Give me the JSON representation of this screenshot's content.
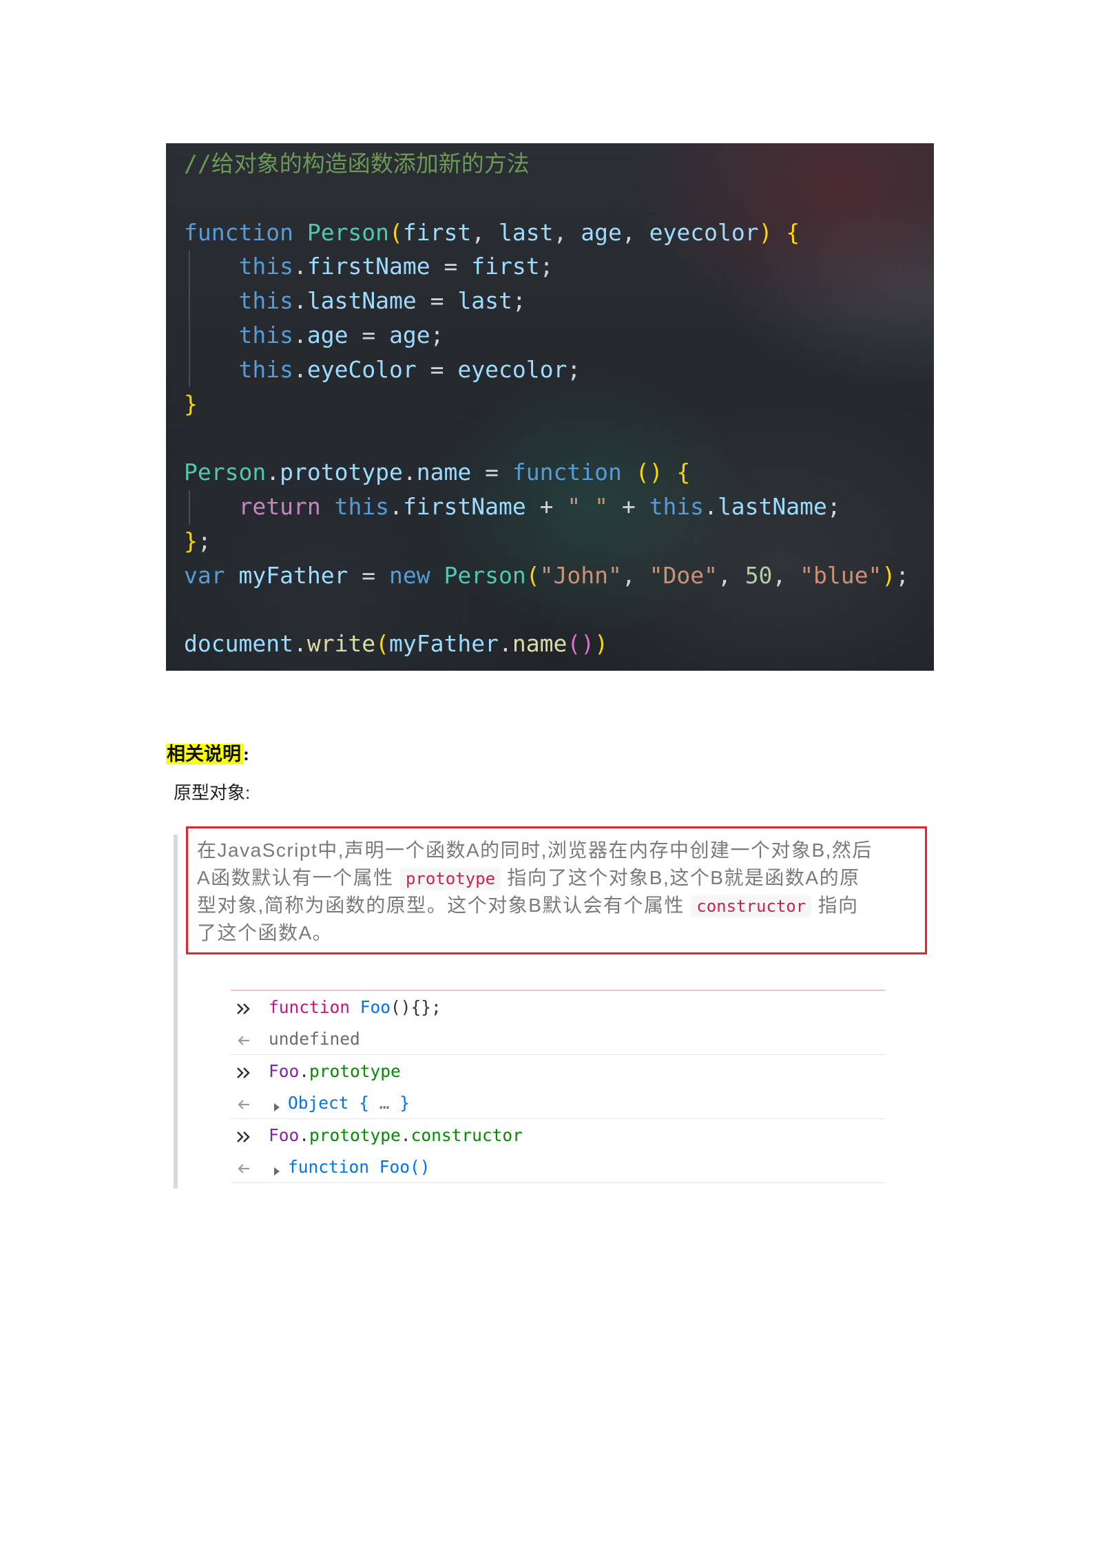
{
  "code_screenshot": {
    "colors": {
      "background": "#24282d",
      "comment": "#6a9955",
      "keyword": "#569cd6",
      "control": "#c586c0",
      "class": "#4ec9b0",
      "variable": "#9cdcfe",
      "function": "#dcdcaa",
      "string": "#ce9178",
      "number": "#b5cea8",
      "bracket": "#ffd700",
      "bracket_nested": "#da70d6",
      "plain": "#d4d4d4"
    },
    "lines": [
      [
        {
          "comment": "//给对象的构造函数添加新的方法"
        }
      ],
      [],
      [
        {
          "keyword": "function"
        },
        {
          "plain": " "
        },
        {
          "class": "Person"
        },
        {
          "bracket": "("
        },
        {
          "variable": "first"
        },
        {
          "plain": ", "
        },
        {
          "variable": "last"
        },
        {
          "plain": ", "
        },
        {
          "variable": "age"
        },
        {
          "plain": ", "
        },
        {
          "variable": "eyecolor"
        },
        {
          "bracket": ")"
        },
        {
          "plain": " "
        },
        {
          "bracket": "{"
        }
      ],
      [
        {
          "plain": "    "
        },
        {
          "keyword": "this"
        },
        {
          "plain": "."
        },
        {
          "variable": "firstName"
        },
        {
          "plain": " = "
        },
        {
          "variable": "first"
        },
        {
          "plain": ";"
        }
      ],
      [
        {
          "plain": "    "
        },
        {
          "keyword": "this"
        },
        {
          "plain": "."
        },
        {
          "variable": "lastName"
        },
        {
          "plain": " = "
        },
        {
          "variable": "last"
        },
        {
          "plain": ";"
        }
      ],
      [
        {
          "plain": "    "
        },
        {
          "keyword": "this"
        },
        {
          "plain": "."
        },
        {
          "variable": "age"
        },
        {
          "plain": " = "
        },
        {
          "variable": "age"
        },
        {
          "plain": ";"
        }
      ],
      [
        {
          "plain": "    "
        },
        {
          "keyword": "this"
        },
        {
          "plain": "."
        },
        {
          "variable": "eyeColor"
        },
        {
          "plain": " = "
        },
        {
          "variable": "eyecolor"
        },
        {
          "plain": ";"
        }
      ],
      [
        {
          "bracket": "}"
        }
      ],
      [],
      [
        {
          "class": "Person"
        },
        {
          "plain": "."
        },
        {
          "variable": "prototype"
        },
        {
          "plain": "."
        },
        {
          "variable": "name"
        },
        {
          "plain": " = "
        },
        {
          "keyword": "function"
        },
        {
          "plain": " "
        },
        {
          "bracket": "()"
        },
        {
          "plain": " "
        },
        {
          "bracket": "{"
        }
      ],
      [
        {
          "plain": "    "
        },
        {
          "control": "return"
        },
        {
          "plain": " "
        },
        {
          "keyword": "this"
        },
        {
          "plain": "."
        },
        {
          "variable": "firstName"
        },
        {
          "plain": " + "
        },
        {
          "string": "\" \""
        },
        {
          "plain": " + "
        },
        {
          "keyword": "this"
        },
        {
          "plain": "."
        },
        {
          "variable": "lastName"
        },
        {
          "plain": ";"
        }
      ],
      [
        {
          "bracket": "}"
        },
        {
          "plain": ";"
        }
      ],
      [
        {
          "keyword": "var"
        },
        {
          "plain": " "
        },
        {
          "variable": "myFather"
        },
        {
          "plain": " = "
        },
        {
          "keyword": "new"
        },
        {
          "plain": " "
        },
        {
          "class": "Person"
        },
        {
          "bracket": "("
        },
        {
          "string": "\"John\""
        },
        {
          "plain": ", "
        },
        {
          "string": "\"Doe\""
        },
        {
          "plain": ", "
        },
        {
          "number": "50"
        },
        {
          "plain": ", "
        },
        {
          "string": "\"blue\""
        },
        {
          "bracket": ")"
        },
        {
          "plain": ";"
        }
      ],
      [],
      [
        {
          "variable": "document"
        },
        {
          "plain": "."
        },
        {
          "function": "write"
        },
        {
          "bracket": "("
        },
        {
          "variable": "myFather"
        },
        {
          "plain": "."
        },
        {
          "function": "name"
        },
        {
          "bracket_nested": "()"
        },
        {
          "bracket": ")"
        }
      ]
    ]
  },
  "notes": {
    "heading": "相关说明",
    "heading_suffix": ":",
    "subheading": "原型对象:",
    "highlight_color": "#ffff00",
    "box_border_color": "#e0262c",
    "inline_code_color": "#c7254e",
    "quote_lines": [
      [
        {
          "text": "在JavaScript中,声明一个函数A的同时,浏览器在内存中创建一个对象B,然后"
        }
      ],
      [
        {
          "text": "A函数默认有一个属性 "
        },
        {
          "code": "prototype"
        },
        {
          "text": " 指向了这个对象B,这个B就是函数A的原"
        }
      ],
      [
        {
          "text": "型对象,简称为函数的原型。这个对象B默认会有个属性 "
        },
        {
          "code": "constructor"
        },
        {
          "text": " 指向"
        }
      ],
      [
        {
          "text": "了这个函数A。"
        }
      ]
    ]
  },
  "console": {
    "colors": {
      "keyword": "#c3157f",
      "name": "#0074e8",
      "punct": "#333333",
      "undefined": "#6b6b6b",
      "variable": "#8a1fa8",
      "property": "#058b00",
      "object": "#0074e8",
      "ellipsis": "#737373",
      "separator": "#e6e6e6",
      "top_border": "#f6c5cc"
    },
    "rows": [
      {
        "icon": "double-chevron-icon",
        "tokens": [
          {
            "keyword": "function"
          },
          {
            "punct": " "
          },
          {
            "name": "Foo"
          },
          {
            "punct": "(){};"
          }
        ]
      },
      {
        "icon": "return-arrow-icon",
        "tokens": [
          {
            "undefined": "undefined"
          }
        ]
      },
      {
        "icon": "double-chevron-icon",
        "tokens": [
          {
            "variable": "Foo"
          },
          {
            "punct": "."
          },
          {
            "property": "prototype"
          }
        ]
      },
      {
        "icon": "return-arrow-icon",
        "expand_icon": "expand-triangle-icon",
        "tokens": [
          {
            "object": "Object { "
          },
          {
            "ellipsis": "…"
          },
          {
            "object": " }"
          }
        ]
      },
      {
        "icon": "double-chevron-icon",
        "tokens": [
          {
            "variable": "Foo"
          },
          {
            "punct": "."
          },
          {
            "property": "prototype"
          },
          {
            "punct": "."
          },
          {
            "property": "constructor"
          }
        ]
      },
      {
        "icon": "return-arrow-icon",
        "expand_icon": "expand-triangle-icon",
        "tokens": [
          {
            "object": "function Foo()"
          }
        ]
      }
    ]
  }
}
